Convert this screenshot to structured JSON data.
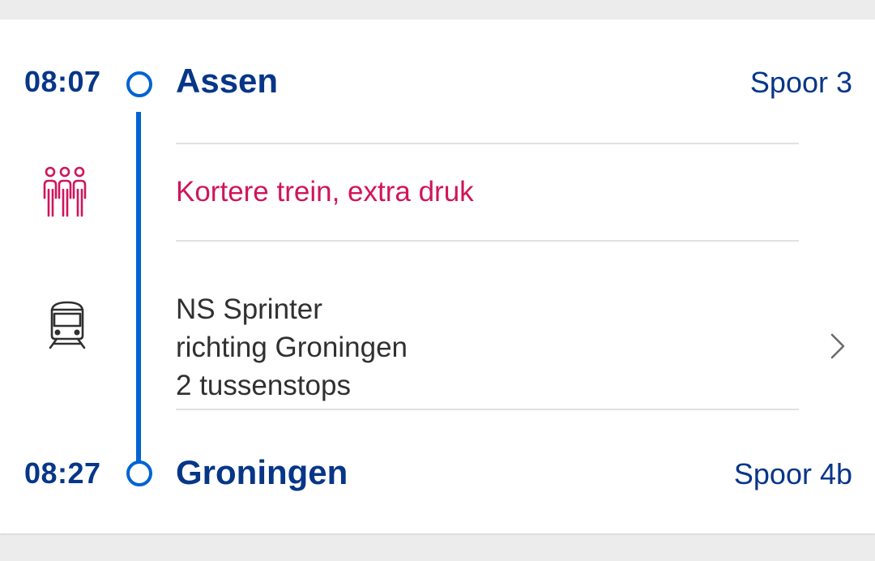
{
  "departure": {
    "time": "08:07",
    "station": "Assen",
    "track": "Spoor 3"
  },
  "notice": {
    "icon": "crowded-people-icon",
    "text": "Kortere trein, extra druk",
    "color": "#d0155c"
  },
  "service": {
    "icon": "train-icon",
    "type": "NS Sprinter",
    "direction": "richting Groningen",
    "stops": "2 tussenstops"
  },
  "arrival": {
    "time": "08:27",
    "station": "Groningen",
    "track": "Spoor 4b"
  },
  "colors": {
    "brand_blue": "#073688",
    "route_line": "#0063d3",
    "warning": "#d0155c"
  }
}
